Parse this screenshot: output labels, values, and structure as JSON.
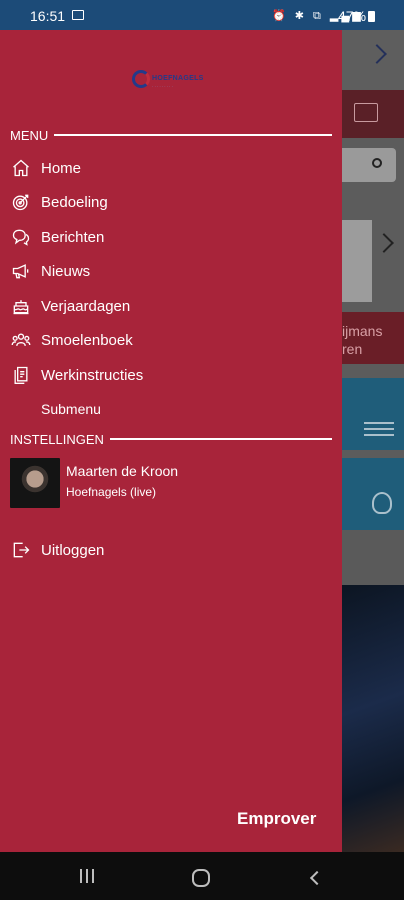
{
  "status_bar": {
    "time": "16:51",
    "icons": "⏰ ✱ ⧉ ▂▄▆",
    "battery": "47%"
  },
  "background": {
    "text_line1": "ijmans",
    "text_line2": "ren"
  },
  "drawer": {
    "logo_text": "HOEFNAGELS",
    "logo_subtext": "· · · · · · · · ·",
    "menu_header": "MENU",
    "items": [
      {
        "label": "Home",
        "icon": "home-icon"
      },
      {
        "label": "Bedoeling",
        "icon": "target-icon"
      },
      {
        "label": "Berichten",
        "icon": "chat-icon"
      },
      {
        "label": "Nieuws",
        "icon": "megaphone-icon"
      },
      {
        "label": "Verjaardagen",
        "icon": "cake-icon"
      },
      {
        "label": "Smoelenboek",
        "icon": "people-icon"
      },
      {
        "label": "Werkinstructies",
        "icon": "document-icon"
      }
    ],
    "submenu": "Submenu",
    "settings_header": "INSTELLINGEN",
    "user": {
      "name": "Maarten de Kroon",
      "organization": "Hoefnagels (live)"
    },
    "logout": "Uitloggen",
    "brand": "Emprover"
  },
  "colors": {
    "drawer_bg": "#a8243a",
    "status_bar": "#1c4b78"
  }
}
